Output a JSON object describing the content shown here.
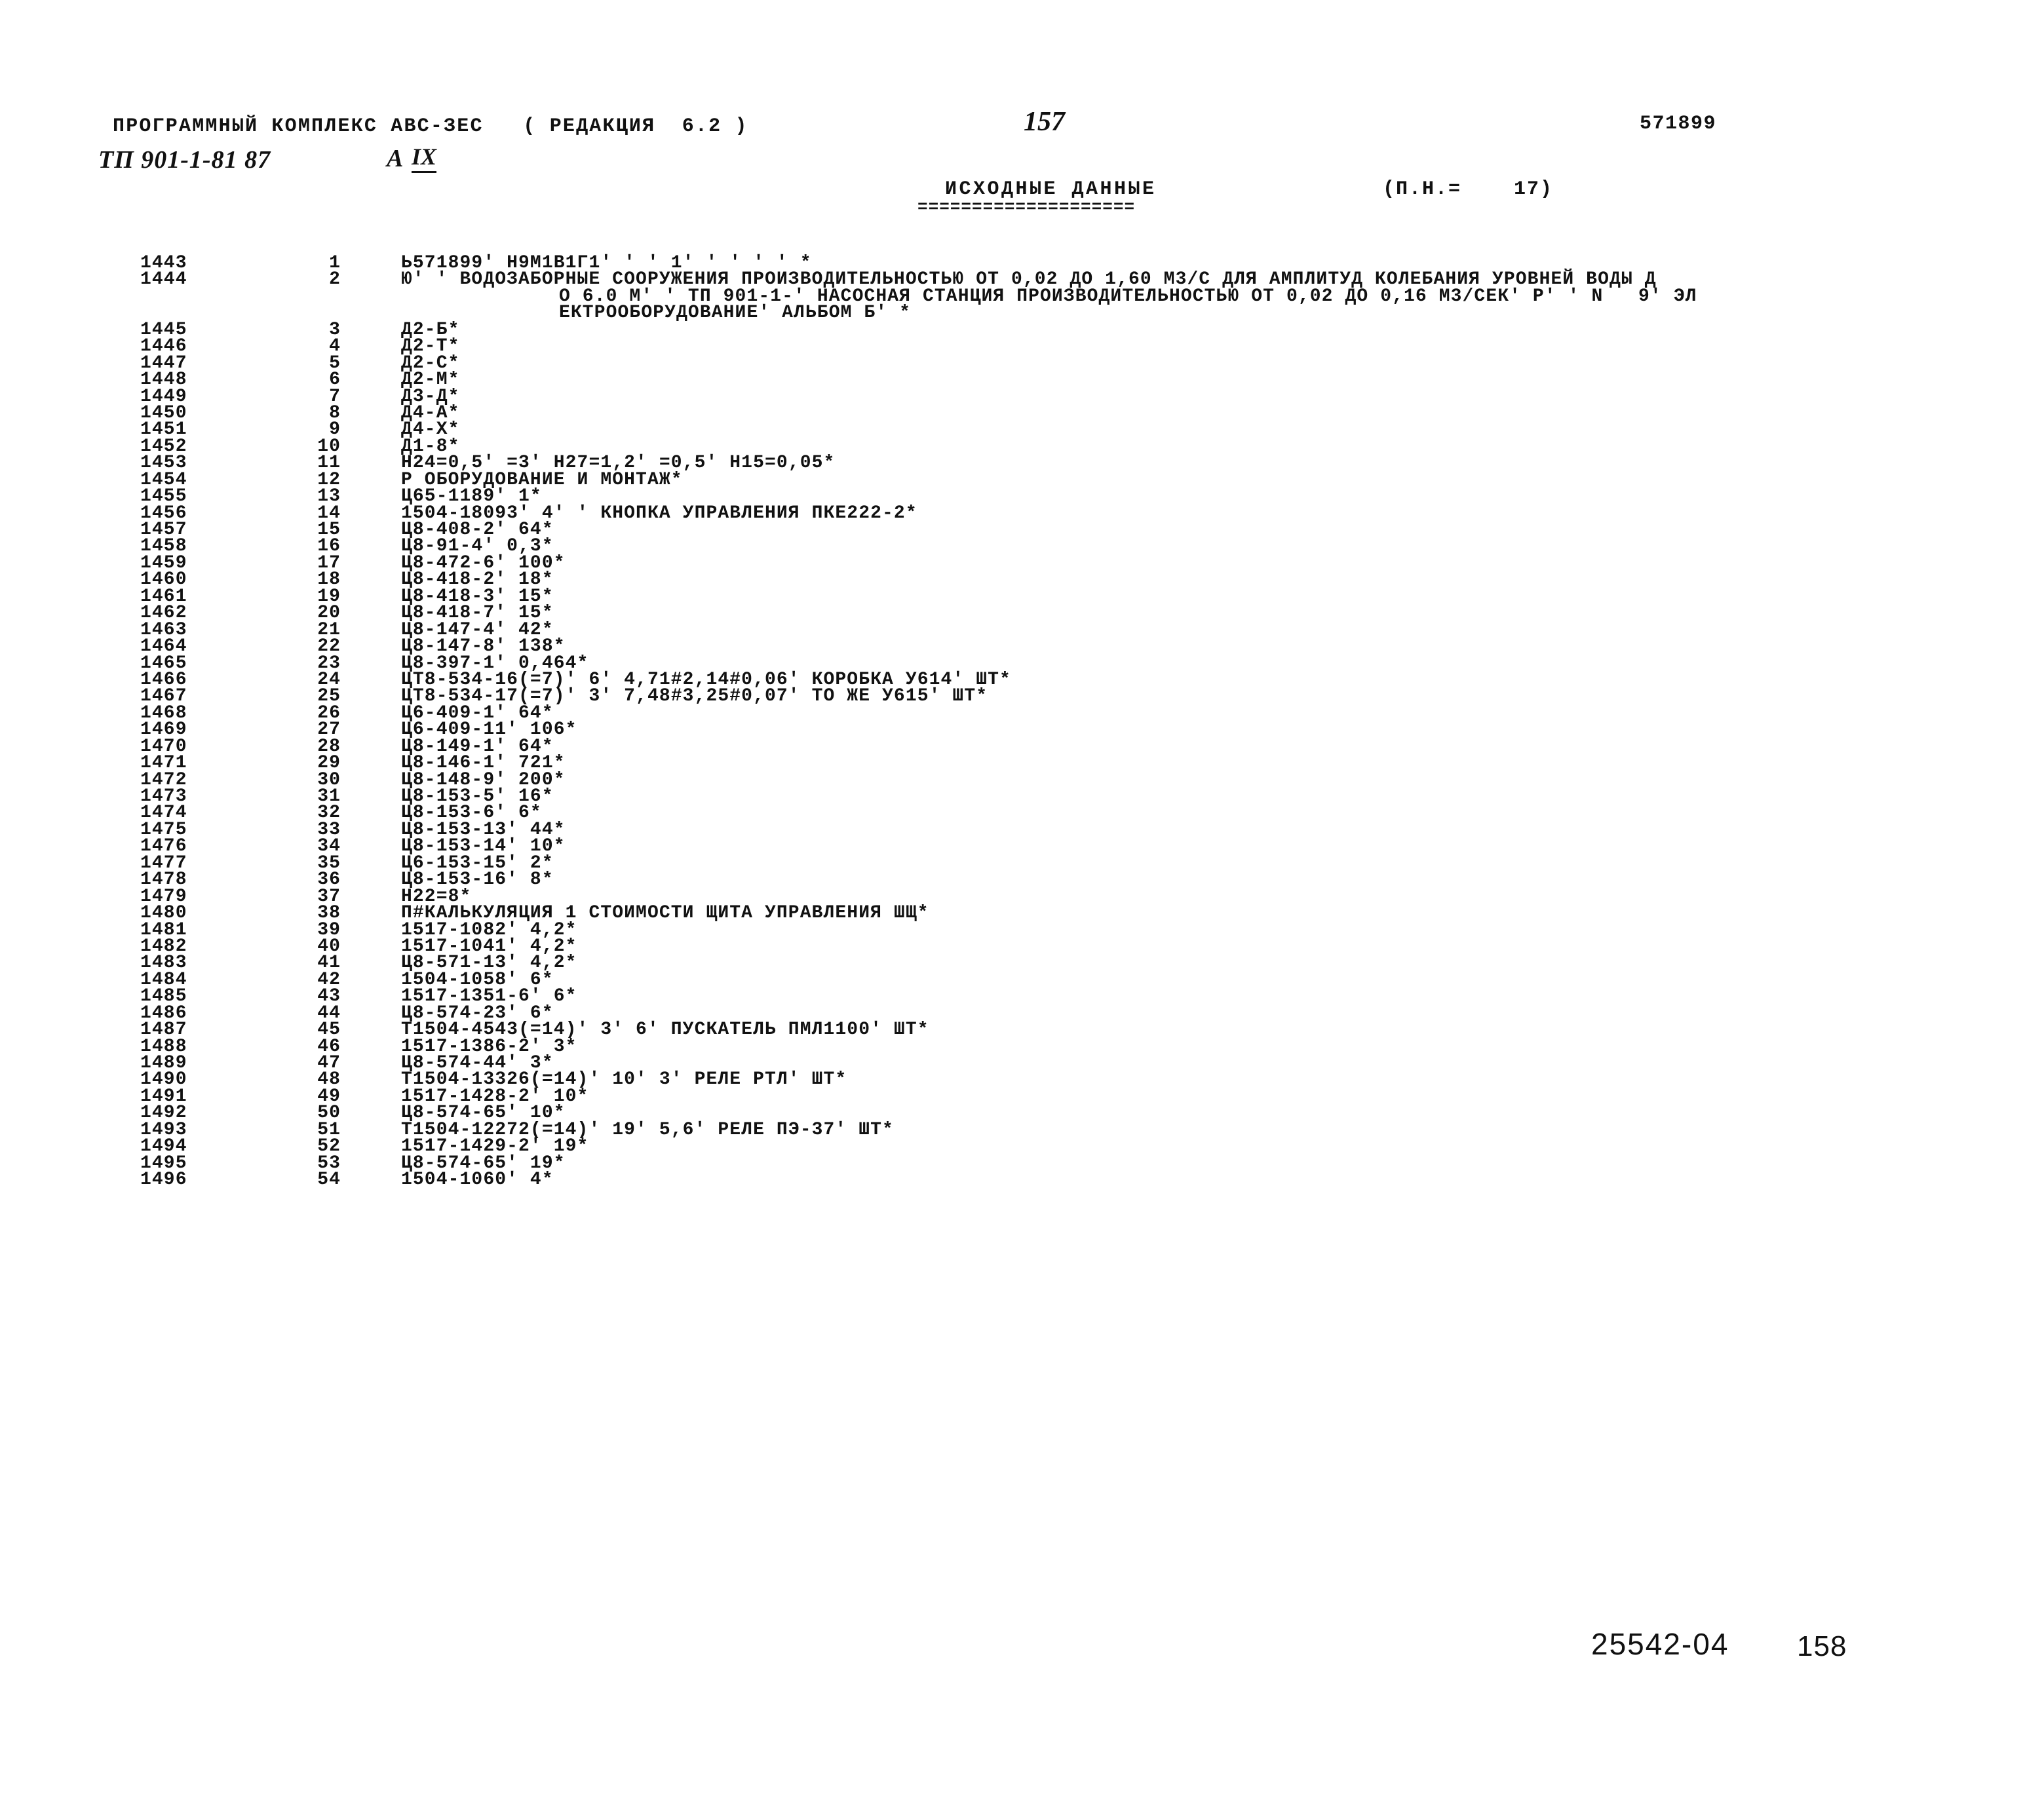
{
  "header": {
    "software_line": "ПРОГРАММНЫЙ КОМПЛЕКС АВС-ЗЕС   ( РЕДАКЦИЯ  6.2 )",
    "project_code": "ТП 901-1-81 87",
    "sheet_letter": "А",
    "sheet_roman": "IX",
    "page_number": "157",
    "doc_code": "571899"
  },
  "section": {
    "title": "ИСХОДНЫЕ ДАННЫЕ",
    "rule": "====================",
    "counter": "(П.Н.=    17)"
  },
  "listing": {
    "rows": [
      {
        "lineno": "1443",
        "seq": "1",
        "text": "Ь571899' Н9М1В1Г1' ' ' 1' ' ' ' ' *",
        "indent": false
      },
      {
        "lineno": "1444",
        "seq": "2",
        "text": "Ю' ' ВОДОЗАБОРНЫЕ СООРУЖЕНИЯ ПРОИЗВОДИТЕЛЬНОСТЬЮ ОТ 0,02 ДО 1,60 М3/С ДЛЯ АМПЛИТУД КОЛЕБАНИЯ УРОВНЕЙ ВОДЫ Д",
        "indent": false
      },
      {
        "lineno": "",
        "seq": "",
        "text": "О 6.0 М' ' ТП 901-1-' НАСОСНАЯ СТАНЦИЯ ПРОИЗВОДИТЕЛЬНОСТЬЮ ОТ 0,02 ДО 0,16 М3/СЕК' Р' ' N   9' ЭЛ",
        "indent": true
      },
      {
        "lineno": "",
        "seq": "",
        "text": "ЕКТРООБОРУДОВАНИЕ' АЛЬБОМ Б' *",
        "indent": true
      },
      {
        "lineno": "1445",
        "seq": "3",
        "text": "Д2-Б*",
        "indent": false
      },
      {
        "lineno": "1446",
        "seq": "4",
        "text": "Д2-Т*",
        "indent": false
      },
      {
        "lineno": "1447",
        "seq": "5",
        "text": "Д2-С*",
        "indent": false
      },
      {
        "lineno": "1448",
        "seq": "6",
        "text": "Д2-М*",
        "indent": false
      },
      {
        "lineno": "1449",
        "seq": "7",
        "text": "Д3-Д*",
        "indent": false
      },
      {
        "lineno": "1450",
        "seq": "8",
        "text": "Д4-А*",
        "indent": false
      },
      {
        "lineno": "1451",
        "seq": "9",
        "text": "Д4-Х*",
        "indent": false
      },
      {
        "lineno": "1452",
        "seq": "10",
        "text": "Д1-8*",
        "indent": false
      },
      {
        "lineno": "1453",
        "seq": "11",
        "text": "Н24=0,5' =3' Н27=1,2' =0,5' Н15=0,05*",
        "indent": false
      },
      {
        "lineno": "1454",
        "seq": "12",
        "text": "Р ОБОРУДОВАНИЕ И МОНТАЖ*",
        "indent": false
      },
      {
        "lineno": "1455",
        "seq": "13",
        "text": "Ц65-1189' 1*",
        "indent": false
      },
      {
        "lineno": "1456",
        "seq": "14",
        "text": "1504-18093' 4' ' КНОПКА УПРАВЛЕНИЯ ПКЕ222-2*",
        "indent": false
      },
      {
        "lineno": "1457",
        "seq": "15",
        "text": "Ц8-408-2' 64*",
        "indent": false
      },
      {
        "lineno": "1458",
        "seq": "16",
        "text": "Ц8-91-4' 0,3*",
        "indent": false
      },
      {
        "lineno": "1459",
        "seq": "17",
        "text": "Ц8-472-6' 100*",
        "indent": false
      },
      {
        "lineno": "1460",
        "seq": "18",
        "text": "Ц8-418-2' 18*",
        "indent": false
      },
      {
        "lineno": "1461",
        "seq": "19",
        "text": "Ц8-418-3' 15*",
        "indent": false
      },
      {
        "lineno": "1462",
        "seq": "20",
        "text": "Ц8-418-7' 15*",
        "indent": false
      },
      {
        "lineno": "1463",
        "seq": "21",
        "text": "Ц8-147-4' 42*",
        "indent": false
      },
      {
        "lineno": "1464",
        "seq": "22",
        "text": "Ц8-147-8' 138*",
        "indent": false
      },
      {
        "lineno": "1465",
        "seq": "23",
        "text": "Ц8-397-1' 0,464*",
        "indent": false
      },
      {
        "lineno": "1466",
        "seq": "24",
        "text": "ЦТ8-534-16(=7)' 6' 4,71#2,14#0,06' КОРОБКА У614' ШТ*",
        "indent": false
      },
      {
        "lineno": "1467",
        "seq": "25",
        "text": "ЦТ8-534-17(=7)' 3' 7,48#3,25#0,07' ТО ЖЕ У615' ШТ*",
        "indent": false
      },
      {
        "lineno": "1468",
        "seq": "26",
        "text": "Ц6-409-1' 64*",
        "indent": false
      },
      {
        "lineno": "1469",
        "seq": "27",
        "text": "Ц6-409-11' 106*",
        "indent": false
      },
      {
        "lineno": "1470",
        "seq": "28",
        "text": "Ц8-149-1' 64*",
        "indent": false
      },
      {
        "lineno": "1471",
        "seq": "29",
        "text": "Ц8-146-1' 721*",
        "indent": false
      },
      {
        "lineno": "1472",
        "seq": "30",
        "text": "Ц8-148-9' 200*",
        "indent": false
      },
      {
        "lineno": "1473",
        "seq": "31",
        "text": "Ц8-153-5' 16*",
        "indent": false
      },
      {
        "lineno": "1474",
        "seq": "32",
        "text": "Ц8-153-6' 6*",
        "indent": false
      },
      {
        "lineno": "1475",
        "seq": "33",
        "text": "Ц8-153-13' 44*",
        "indent": false
      },
      {
        "lineno": "1476",
        "seq": "34",
        "text": "Ц8-153-14' 10*",
        "indent": false
      },
      {
        "lineno": "1477",
        "seq": "35",
        "text": "Ц6-153-15' 2*",
        "indent": false
      },
      {
        "lineno": "1478",
        "seq": "36",
        "text": "Ц8-153-16' 8*",
        "indent": false
      },
      {
        "lineno": "1479",
        "seq": "37",
        "text": "Н22=8*",
        "indent": false
      },
      {
        "lineno": "1480",
        "seq": "38",
        "text": "П#КАЛЬКУЛЯЦИЯ 1 СТОИМОСТИ ЩИТА УПРАВЛЕНИЯ ШЩ*",
        "indent": false
      },
      {
        "lineno": "1481",
        "seq": "39",
        "text": "1517-1082' 4,2*",
        "indent": false
      },
      {
        "lineno": "1482",
        "seq": "40",
        "text": "1517-1041' 4,2*",
        "indent": false
      },
      {
        "lineno": "1483",
        "seq": "41",
        "text": "Ц8-571-13' 4,2*",
        "indent": false
      },
      {
        "lineno": "1484",
        "seq": "42",
        "text": "1504-1058' 6*",
        "indent": false
      },
      {
        "lineno": "1485",
        "seq": "43",
        "text": "1517-1351-6' 6*",
        "indent": false
      },
      {
        "lineno": "1486",
        "seq": "44",
        "text": "Ц8-574-23' 6*",
        "indent": false
      },
      {
        "lineno": "1487",
        "seq": "45",
        "text": "Т1504-4543(=14)' 3' 6' ПУСКАТЕЛЬ ПМЛ1100' ШТ*",
        "indent": false
      },
      {
        "lineno": "1488",
        "seq": "46",
        "text": "1517-1386-2' 3*",
        "indent": false
      },
      {
        "lineno": "1489",
        "seq": "47",
        "text": "Ц8-574-44' 3*",
        "indent": false
      },
      {
        "lineno": "1490",
        "seq": "48",
        "text": "Т1504-13326(=14)' 10' 3' РЕЛЕ РТЛ' ШТ*",
        "indent": false
      },
      {
        "lineno": "1491",
        "seq": "49",
        "text": "1517-1428-2' 10*",
        "indent": false
      },
      {
        "lineno": "1492",
        "seq": "50",
        "text": "Ц8-574-65' 10*",
        "indent": false
      },
      {
        "lineno": "1493",
        "seq": "51",
        "text": "Т1504-12272(=14)' 19' 5,6' РЕЛЕ ПЭ-37' ШТ*",
        "indent": false
      },
      {
        "lineno": "1494",
        "seq": "52",
        "text": "1517-1429-2' 19*",
        "indent": false
      },
      {
        "lineno": "1495",
        "seq": "53",
        "text": "Ц8-574-65' 19*",
        "indent": false
      },
      {
        "lineno": "1496",
        "seq": "54",
        "text": "1504-1060' 4*",
        "indent": false
      }
    ]
  },
  "footer": {
    "archive_code": "25542-04",
    "sheet_number": "158"
  }
}
